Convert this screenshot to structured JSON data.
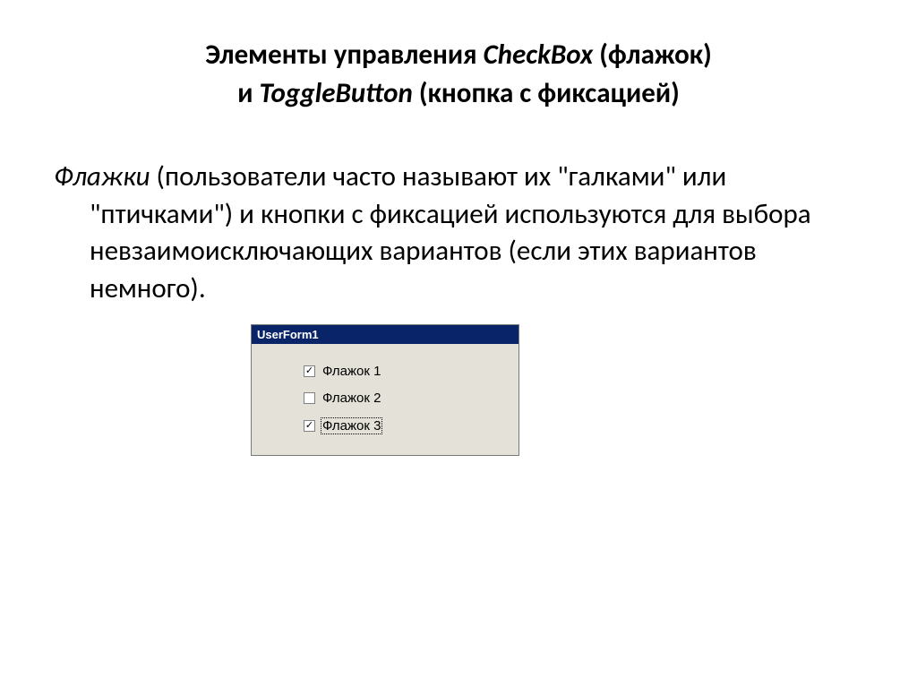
{
  "title": {
    "line1_prefix": "Элементы управления ",
    "line1_italic": "CheckBox",
    "line1_suffix": " (флажок)",
    "line2_prefix": "и ",
    "line2_italic": "ToggleButton",
    "line2_suffix": " (кнопка с фиксацией)"
  },
  "paragraph": {
    "italic_word": "Флажки",
    "rest": " (пользователи часто называют их \"галками\" или \"птичками\") и кнопки с фиксацией используются для выбора невзаимоисключающих вариантов (если этих вариантов немного)."
  },
  "userform": {
    "title": "UserForm1",
    "checkboxes": [
      {
        "label": "Флажок 1",
        "checked": true,
        "focused": false
      },
      {
        "label": "Флажок 2",
        "checked": false,
        "focused": false
      },
      {
        "label": "Флажок 3",
        "checked": true,
        "focused": true
      }
    ]
  }
}
